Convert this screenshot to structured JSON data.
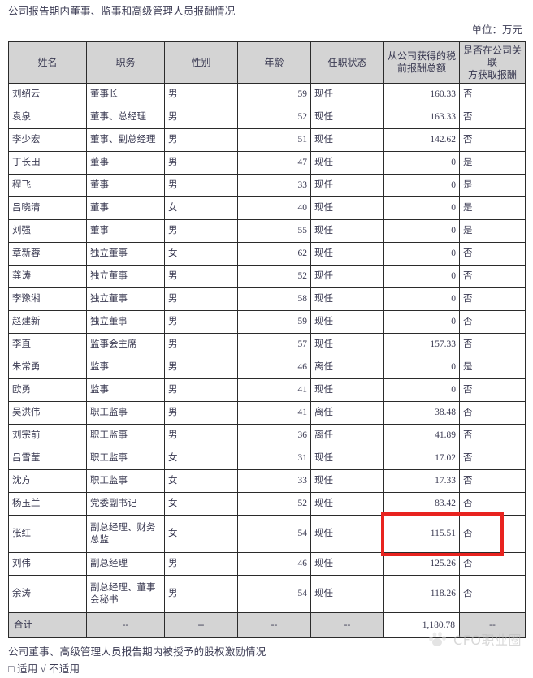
{
  "document": {
    "title": "公司报告期内董事、监事和高级管理人员报酬情况",
    "unit_label": "单位：万元"
  },
  "table": {
    "headers": {
      "name": "姓名",
      "position": "职务",
      "gender": "性别",
      "age": "年龄",
      "status": "任职状态",
      "pay_line1": "从公司获得的税",
      "pay_line2": "前报酬总额",
      "related_line1": "是否在公司关联",
      "related_line2": "方获取报酬"
    },
    "rows": [
      {
        "name": "刘绍云",
        "position": "董事长",
        "gender": "男",
        "age": "59",
        "status": "现任",
        "pay": "160.33",
        "related": "否",
        "tall": false
      },
      {
        "name": "袁泉",
        "position": "董事、总经理",
        "gender": "男",
        "age": "52",
        "status": "现任",
        "pay": "163.33",
        "related": "否",
        "tall": false
      },
      {
        "name": "李少宏",
        "position": "董事、副总经理",
        "gender": "男",
        "age": "51",
        "status": "现任",
        "pay": "142.62",
        "related": "否",
        "tall": false
      },
      {
        "name": "丁长田",
        "position": "董事",
        "gender": "男",
        "age": "47",
        "status": "现任",
        "pay": "0",
        "related": "是",
        "tall": false
      },
      {
        "name": "程飞",
        "position": "董事",
        "gender": "男",
        "age": "33",
        "status": "现任",
        "pay": "0",
        "related": "是",
        "tall": false
      },
      {
        "name": "吕晓清",
        "position": "董事",
        "gender": "女",
        "age": "40",
        "status": "现任",
        "pay": "0",
        "related": "是",
        "tall": false
      },
      {
        "name": "刘强",
        "position": "董事",
        "gender": "男",
        "age": "55",
        "status": "现任",
        "pay": "0",
        "related": "是",
        "tall": false
      },
      {
        "name": "章新蓉",
        "position": "独立董事",
        "gender": "女",
        "age": "62",
        "status": "现任",
        "pay": "0",
        "related": "否",
        "tall": false
      },
      {
        "name": "龚涛",
        "position": "独立董事",
        "gender": "男",
        "age": "52",
        "status": "现任",
        "pay": "0",
        "related": "否",
        "tall": false
      },
      {
        "name": "李豫湘",
        "position": "独立董事",
        "gender": "男",
        "age": "58",
        "status": "现任",
        "pay": "0",
        "related": "否",
        "tall": false
      },
      {
        "name": "赵建新",
        "position": "独立董事",
        "gender": "男",
        "age": "59",
        "status": "现任",
        "pay": "0",
        "related": "否",
        "tall": false
      },
      {
        "name": "李直",
        "position": "监事会主席",
        "gender": "男",
        "age": "57",
        "status": "现任",
        "pay": "157.33",
        "related": "否",
        "tall": false
      },
      {
        "name": "朱常勇",
        "position": "监事",
        "gender": "男",
        "age": "46",
        "status": "离任",
        "pay": "0",
        "related": "是",
        "tall": false
      },
      {
        "name": "欧勇",
        "position": "监事",
        "gender": "男",
        "age": "41",
        "status": "现任",
        "pay": "0",
        "related": "否",
        "tall": false
      },
      {
        "name": "吴洪伟",
        "position": "职工监事",
        "gender": "男",
        "age": "41",
        "status": "离任",
        "pay": "38.48",
        "related": "否",
        "tall": false
      },
      {
        "name": "刘宗前",
        "position": "职工监事",
        "gender": "男",
        "age": "36",
        "status": "离任",
        "pay": "41.89",
        "related": "否",
        "tall": false
      },
      {
        "name": "吕雪莹",
        "position": "职工监事",
        "gender": "女",
        "age": "31",
        "status": "现任",
        "pay": "17.02",
        "related": "否",
        "tall": false
      },
      {
        "name": "沈方",
        "position": "职工监事",
        "gender": "女",
        "age": "33",
        "status": "现任",
        "pay": "17.33",
        "related": "否",
        "tall": false
      },
      {
        "name": "杨玉兰",
        "position": "党委副书记",
        "gender": "女",
        "age": "52",
        "status": "现任",
        "pay": "83.42",
        "related": "否",
        "tall": false
      },
      {
        "name": "张红",
        "position": "副总经理、财务总监",
        "gender": "女",
        "age": "54",
        "status": "现任",
        "pay": "115.51",
        "related": "否",
        "tall": true
      },
      {
        "name": "刘伟",
        "position": "副总经理",
        "gender": "男",
        "age": "46",
        "status": "现任",
        "pay": "125.26",
        "related": "否",
        "tall": false
      },
      {
        "name": "余涛",
        "position": "副总经理、董事会秘书",
        "gender": "男",
        "age": "54",
        "status": "现任",
        "pay": "118.26",
        "related": "否",
        "tall": true
      }
    ],
    "total": {
      "name": "合计",
      "position": "--",
      "gender": "--",
      "age": "--",
      "status": "--",
      "pay": "1,180.78",
      "related": "--"
    }
  },
  "annotation": {
    "highlight_color": "#e8231f"
  },
  "footnotes": {
    "line1": "公司董事、高级管理人员报告期内被授予的股权激励情况",
    "line2": "□ 适用 √ 不适用"
  },
  "watermark": {
    "text": "CFO职业圈"
  }
}
